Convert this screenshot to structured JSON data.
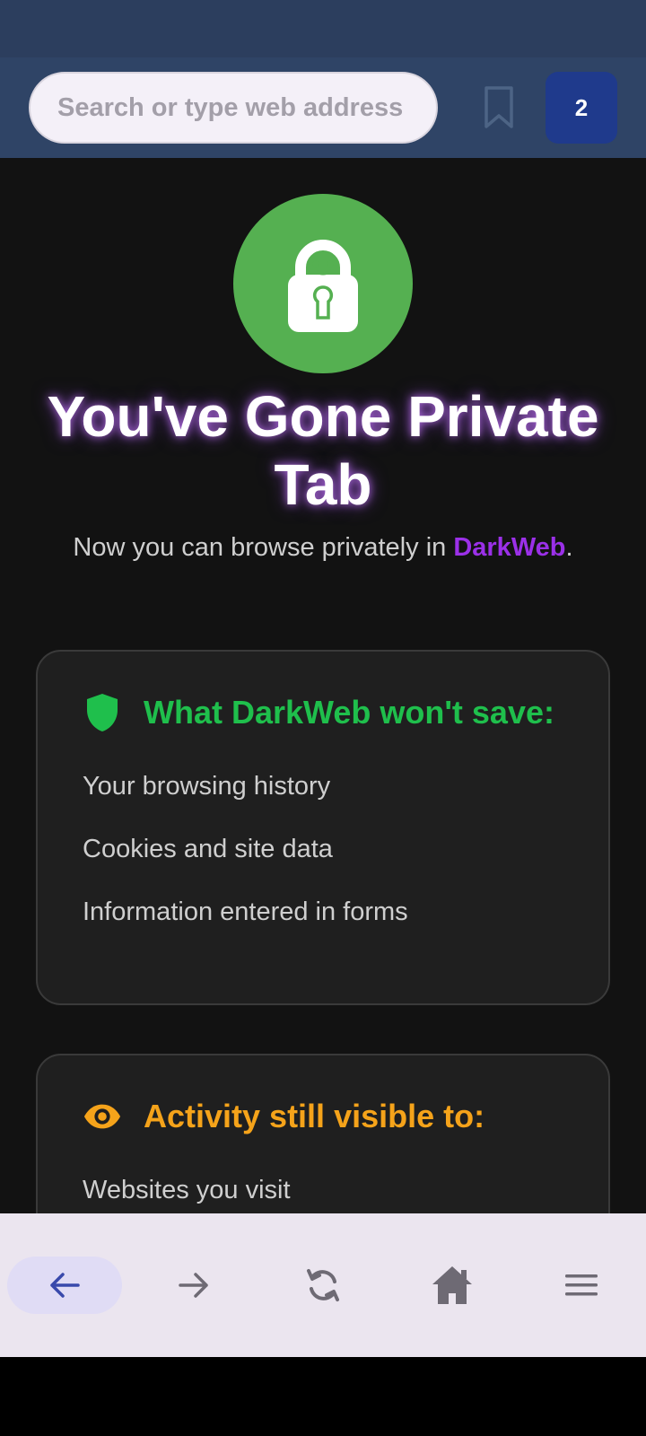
{
  "search": {
    "placeholder": "Search or type web address"
  },
  "tabs": {
    "count": "2"
  },
  "private_page": {
    "title": "You've Gone Private Tab",
    "subtitle_prefix": "Now you can browse privately in ",
    "brand": "DarkWeb",
    "subtitle_suffix": "."
  },
  "card_not_saved": {
    "icon": "shield-icon",
    "heading": "What DarkWeb won't save:",
    "items": [
      "Your browsing history",
      "Cookies and site data",
      "Information entered in forms"
    ]
  },
  "card_visible": {
    "icon": "eye-icon",
    "heading": "Activity still visible to:",
    "items": [
      "Websites you visit"
    ]
  },
  "nav": {
    "back": "arrow-left-icon",
    "forward": "arrow-right-icon",
    "reload": "refresh-icon",
    "home": "home-icon",
    "menu": "menu-icon"
  },
  "colors": {
    "top_bar": "#2f4466",
    "tabs_button": "#1f3a8c",
    "logo_green": "#55b051",
    "brand_purple": "#9b30e8",
    "heading_green": "#1fbf4c",
    "heading_orange": "#f5a31a",
    "nav_active": "#3949ab"
  }
}
